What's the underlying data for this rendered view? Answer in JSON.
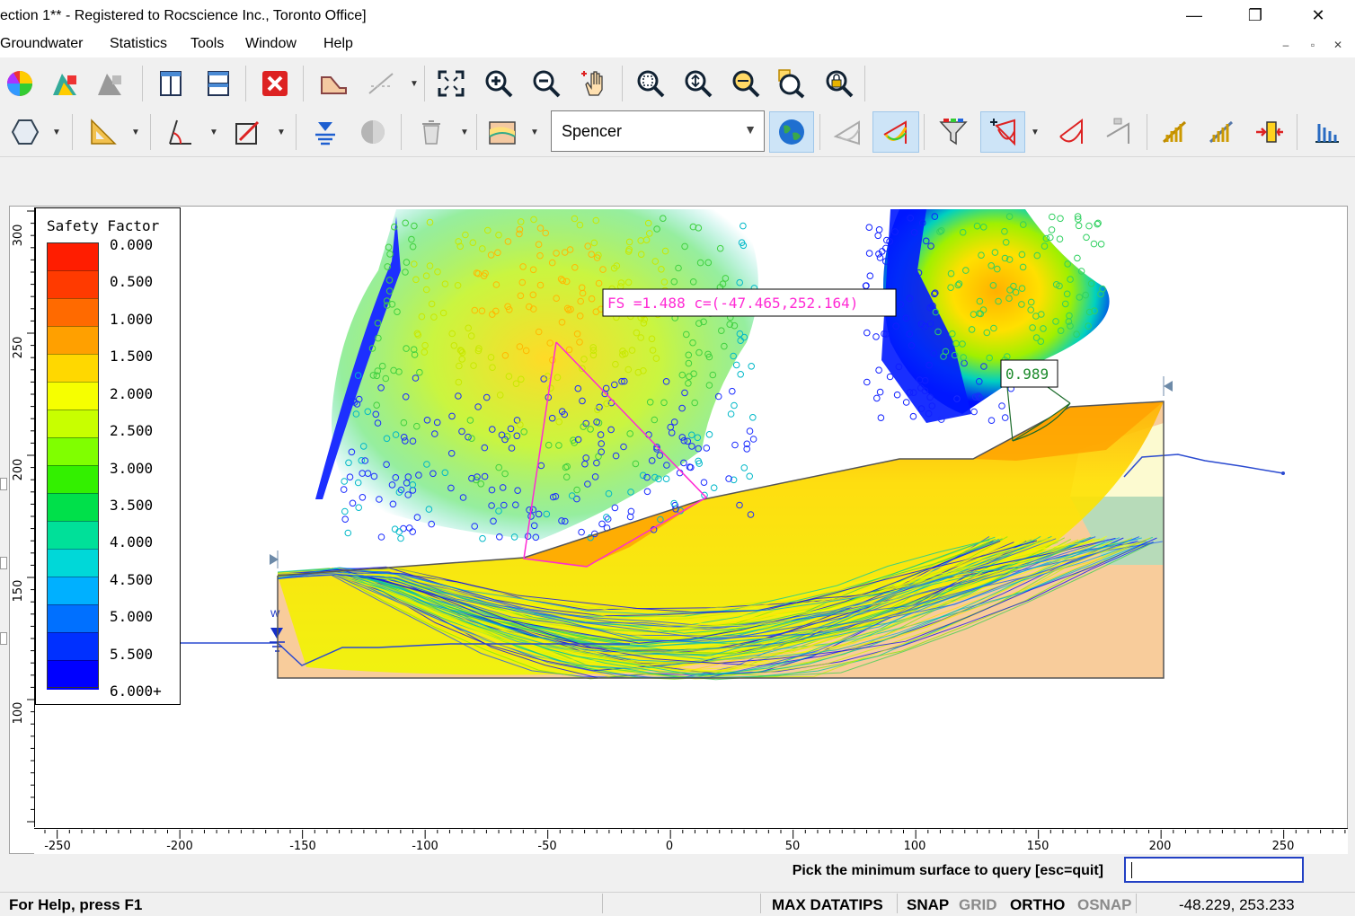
{
  "window": {
    "title": "ection 1** - Registered to Rocscience Inc., Toronto Office]",
    "controls": {
      "minimize": "—",
      "restore": "❐",
      "close": "✕"
    }
  },
  "menu": [
    "Groundwater",
    "Statistics",
    "Tools",
    "Window",
    "Help"
  ],
  "mdi_controls": {
    "minimize": "–",
    "restore": "▫",
    "close": "✕"
  },
  "toolbar": {
    "method": "Spencer"
  },
  "legend": {
    "title": "Safety Factor",
    "values": [
      "0.000",
      "0.500",
      "1.000",
      "1.500",
      "2.000",
      "2.500",
      "3.000",
      "3.500",
      "4.000",
      "4.500",
      "5.000",
      "5.500",
      "6.000+"
    ],
    "colors": [
      "#ff1d00",
      "#ff3a00",
      "#ff6a00",
      "#ffa000",
      "#ffd800",
      "#f6ff00",
      "#c8ff00",
      "#80ff00",
      "#33f000",
      "#00e04a",
      "#00e099",
      "#00d8d8",
      "#00b0ff",
      "#0070ff",
      "#0030ff",
      "#0000ff"
    ]
  },
  "plot": {
    "annotations": {
      "global_min_label": "FS =1.488 c=(-47.465,252.164)",
      "queried_min_label": "0.989"
    },
    "x_axis": {
      "ticks": [
        "-250",
        "-200",
        "-150",
        "-100",
        "-50",
        "0",
        "50",
        "100",
        "150",
        "200",
        "250"
      ]
    },
    "y_axis": {
      "ticks": [
        "300",
        "250",
        "200",
        "150",
        "100"
      ]
    },
    "water_marker": "W"
  },
  "prompt": {
    "text": "Pick the minimum surface to query [esc=quit]"
  },
  "statusbar": {
    "help": "For Help, press F1",
    "max_datatips": "MAX DATATIPS",
    "snap": "SNAP",
    "grid": "GRID",
    "ortho": "ORTHO",
    "osnap": "OSNAP",
    "coords": "-48.229,  253.233"
  }
}
